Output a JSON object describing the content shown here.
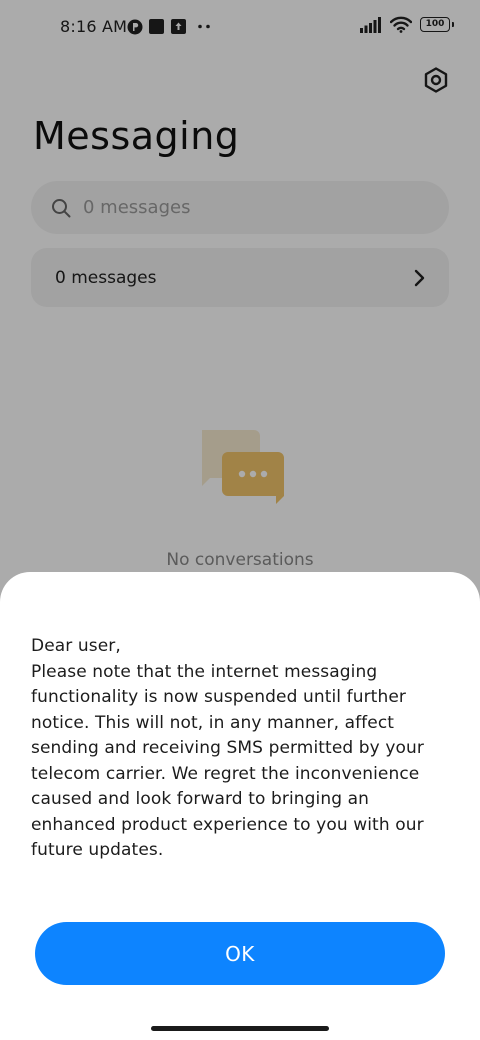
{
  "status_bar": {
    "time": "8:16 AM",
    "battery": "100",
    "icons": [
      "notification-p-icon",
      "notification-square-icon",
      "upload-icon",
      "more-dots-icon",
      "signal-icon",
      "wifi-icon",
      "battery-icon"
    ]
  },
  "header": {
    "title": "Messaging",
    "settings_icon": "settings-hex-icon"
  },
  "search": {
    "placeholder": "0 messages",
    "icon": "search-icon"
  },
  "messages_row": {
    "label": "0 messages",
    "icon": "chevron-right-icon"
  },
  "empty_state": {
    "icon": "chat-bubbles-icon",
    "text": "No conversations"
  },
  "dialog": {
    "lines": [
      "Dear user,",
      "Please note that the internet messaging",
      "functionality is now suspended until further",
      "notice. This will not, in any manner, affect",
      "sending and receiving SMS permitted by your",
      "telecom carrier. We regret the inconvenience",
      "caused and look forward to bringing an",
      "enhanced product experience to you with our",
      "future updates."
    ],
    "ok_label": "OK"
  },
  "colors": {
    "accent": "#0d84ff",
    "overlay": "#00000055",
    "empty_icon": "#f1c36a"
  }
}
